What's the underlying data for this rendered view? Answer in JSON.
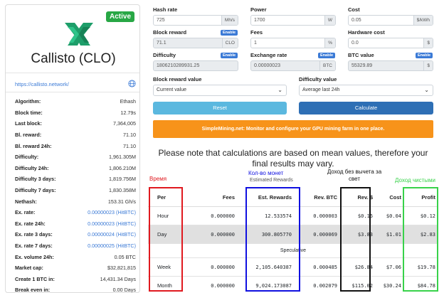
{
  "coin": {
    "badge": "Active",
    "name": "Callisto (CLO)",
    "url": "https://callisto.network/",
    "stats": [
      {
        "k": "Algorithm:",
        "v": "Ethash",
        "link": false
      },
      {
        "k": "Block time:",
        "v": "12.79s",
        "link": false
      },
      {
        "k": "Last block:",
        "v": "7,364,005",
        "link": false
      },
      {
        "k": "Bl. reward:",
        "v": "71.10",
        "link": false,
        "icon": true
      },
      {
        "k": "Bl. reward 24h:",
        "v": "71.10",
        "link": false,
        "icon": true
      },
      {
        "k": "Difficulty:",
        "v": "1,961.305M",
        "link": false,
        "icon": true
      },
      {
        "k": "Difficulty 24h:",
        "v": "1,806.210M",
        "link": false,
        "icon": true
      },
      {
        "k": "Difficulty 3 days:",
        "v": "1,819.756M",
        "link": false,
        "icon": true
      },
      {
        "k": "Difficulty 7 days:",
        "v": "1,830.358M",
        "link": false,
        "icon": true
      },
      {
        "k": "Nethash:",
        "v": "153.31 Gh/s",
        "link": false
      },
      {
        "k": "Ex. rate:",
        "v": "0.00000023 (HitBTC)",
        "link": true
      },
      {
        "k": "Ex. rate 24h:",
        "v": "0.00000023 (HitBTC)",
        "link": true
      },
      {
        "k": "Ex. rate 3 days:",
        "v": "0.00000024 (HitBTC)",
        "link": true
      },
      {
        "k": "Ex. rate 7 days:",
        "v": "0.00000025 (HitBTC)",
        "link": true
      },
      {
        "k": "Ex. volume 24h:",
        "v": "0.05 BTC",
        "link": false
      },
      {
        "k": "Market cap:",
        "v": "$32,821,815",
        "link": false
      },
      {
        "k": "Create 1 BTC in:",
        "v": "14,431.34 Days",
        "link": false
      },
      {
        "k": "Break even in:",
        "v": "0.00 Days",
        "link": false
      }
    ]
  },
  "form": {
    "hash_rate": {
      "label": "Hash rate",
      "value": "725",
      "unit": "Mh/s"
    },
    "power": {
      "label": "Power",
      "value": "1700",
      "unit": "W"
    },
    "cost": {
      "label": "Cost",
      "value": "0.05",
      "unit": "$/kWh"
    },
    "block_reward": {
      "label": "Block reward",
      "enable": "Enable",
      "value": "71.1",
      "unit": "CLO"
    },
    "fees": {
      "label": "Fees",
      "value": "1",
      "unit": "%"
    },
    "hardware_cost": {
      "label": "Hardware cost",
      "value": "0.0",
      "unit": "$"
    },
    "difficulty": {
      "label": "Difficulty",
      "enable": "Enable",
      "value": "1806210289931.25"
    },
    "exchange_rate": {
      "label": "Exchange rate",
      "enable": "Enable",
      "value": "0.00000023",
      "unit": "BTC"
    },
    "btc_value": {
      "label": "BTC value",
      "enable": "Enable",
      "value": "55329.89",
      "unit": "$"
    },
    "block_reward_value": {
      "label": "Block reward value",
      "selected": "Current value"
    },
    "difficulty_value": {
      "label": "Difficulty value",
      "selected": "Average last 24h"
    },
    "reset": "Reset",
    "calculate": "Calculate"
  },
  "promo": "SimpleMining.net: Monitor and configure your GPU mining farm in one place.",
  "note": "Please note that calculations are based on mean values, therefore your final results may vary.",
  "results": {
    "caption": "Estimated Rewards",
    "headers": [
      "Per",
      "Fees",
      "Est. Rewards",
      "Rev. BTC",
      "Rev. $",
      "Cost",
      "Profit"
    ],
    "rows": [
      [
        "Hour",
        "0.000000",
        "12.533574",
        "0.000003",
        "$0.16",
        "$0.04",
        "$0.12"
      ],
      [
        "Day",
        "0.000000",
        "300.805770",
        "0.000069",
        "$3.83",
        "$1.01",
        "$2.83"
      ]
    ],
    "speculative": "Speculative",
    "spec_rows": [
      [
        "Week",
        "0.000000",
        "2,105.640387",
        "0.000485",
        "$26.84",
        "$7.06",
        "$19.78"
      ],
      [
        "Month",
        "0.000000",
        "9,024.173087",
        "0.002079",
        "$115.02",
        "$30.24",
        "$84.78"
      ]
    ]
  },
  "annotations": {
    "time": "Время",
    "coins": "Кол-во монет",
    "income": "Доход без вычета за свет",
    "net": "Доход чистыми"
  },
  "colors": {
    "active": "#28a745",
    "accent": "#3b7ad6",
    "promo": "#f7931a",
    "ann_red": "#e0191f",
    "ann_blue": "#1010e0",
    "ann_black": "#111111",
    "ann_green": "#38d24a"
  }
}
